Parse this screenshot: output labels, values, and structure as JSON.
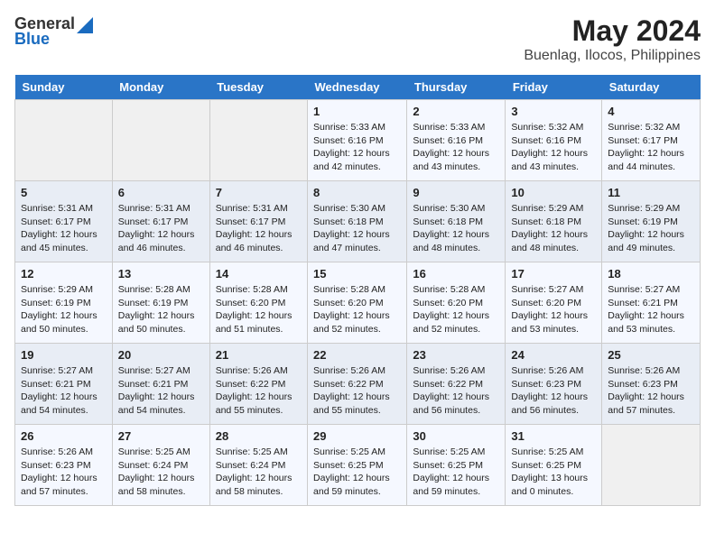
{
  "header": {
    "logo_general": "General",
    "logo_blue": "Blue",
    "title": "May 2024",
    "subtitle": "Buenlag, Ilocos, Philippines"
  },
  "days_of_week": [
    "Sunday",
    "Monday",
    "Tuesday",
    "Wednesday",
    "Thursday",
    "Friday",
    "Saturday"
  ],
  "weeks": [
    [
      {
        "num": "",
        "info": ""
      },
      {
        "num": "",
        "info": ""
      },
      {
        "num": "",
        "info": ""
      },
      {
        "num": "1",
        "info": "Sunrise: 5:33 AM\nSunset: 6:16 PM\nDaylight: 12 hours\nand 42 minutes."
      },
      {
        "num": "2",
        "info": "Sunrise: 5:33 AM\nSunset: 6:16 PM\nDaylight: 12 hours\nand 43 minutes."
      },
      {
        "num": "3",
        "info": "Sunrise: 5:32 AM\nSunset: 6:16 PM\nDaylight: 12 hours\nand 43 minutes."
      },
      {
        "num": "4",
        "info": "Sunrise: 5:32 AM\nSunset: 6:17 PM\nDaylight: 12 hours\nand 44 minutes."
      }
    ],
    [
      {
        "num": "5",
        "info": "Sunrise: 5:31 AM\nSunset: 6:17 PM\nDaylight: 12 hours\nand 45 minutes."
      },
      {
        "num": "6",
        "info": "Sunrise: 5:31 AM\nSunset: 6:17 PM\nDaylight: 12 hours\nand 46 minutes."
      },
      {
        "num": "7",
        "info": "Sunrise: 5:31 AM\nSunset: 6:17 PM\nDaylight: 12 hours\nand 46 minutes."
      },
      {
        "num": "8",
        "info": "Sunrise: 5:30 AM\nSunset: 6:18 PM\nDaylight: 12 hours\nand 47 minutes."
      },
      {
        "num": "9",
        "info": "Sunrise: 5:30 AM\nSunset: 6:18 PM\nDaylight: 12 hours\nand 48 minutes."
      },
      {
        "num": "10",
        "info": "Sunrise: 5:29 AM\nSunset: 6:18 PM\nDaylight: 12 hours\nand 48 minutes."
      },
      {
        "num": "11",
        "info": "Sunrise: 5:29 AM\nSunset: 6:19 PM\nDaylight: 12 hours\nand 49 minutes."
      }
    ],
    [
      {
        "num": "12",
        "info": "Sunrise: 5:29 AM\nSunset: 6:19 PM\nDaylight: 12 hours\nand 50 minutes."
      },
      {
        "num": "13",
        "info": "Sunrise: 5:28 AM\nSunset: 6:19 PM\nDaylight: 12 hours\nand 50 minutes."
      },
      {
        "num": "14",
        "info": "Sunrise: 5:28 AM\nSunset: 6:20 PM\nDaylight: 12 hours\nand 51 minutes."
      },
      {
        "num": "15",
        "info": "Sunrise: 5:28 AM\nSunset: 6:20 PM\nDaylight: 12 hours\nand 52 minutes."
      },
      {
        "num": "16",
        "info": "Sunrise: 5:28 AM\nSunset: 6:20 PM\nDaylight: 12 hours\nand 52 minutes."
      },
      {
        "num": "17",
        "info": "Sunrise: 5:27 AM\nSunset: 6:20 PM\nDaylight: 12 hours\nand 53 minutes."
      },
      {
        "num": "18",
        "info": "Sunrise: 5:27 AM\nSunset: 6:21 PM\nDaylight: 12 hours\nand 53 minutes."
      }
    ],
    [
      {
        "num": "19",
        "info": "Sunrise: 5:27 AM\nSunset: 6:21 PM\nDaylight: 12 hours\nand 54 minutes."
      },
      {
        "num": "20",
        "info": "Sunrise: 5:27 AM\nSunset: 6:21 PM\nDaylight: 12 hours\nand 54 minutes."
      },
      {
        "num": "21",
        "info": "Sunrise: 5:26 AM\nSunset: 6:22 PM\nDaylight: 12 hours\nand 55 minutes."
      },
      {
        "num": "22",
        "info": "Sunrise: 5:26 AM\nSunset: 6:22 PM\nDaylight: 12 hours\nand 55 minutes."
      },
      {
        "num": "23",
        "info": "Sunrise: 5:26 AM\nSunset: 6:22 PM\nDaylight: 12 hours\nand 56 minutes."
      },
      {
        "num": "24",
        "info": "Sunrise: 5:26 AM\nSunset: 6:23 PM\nDaylight: 12 hours\nand 56 minutes."
      },
      {
        "num": "25",
        "info": "Sunrise: 5:26 AM\nSunset: 6:23 PM\nDaylight: 12 hours\nand 57 minutes."
      }
    ],
    [
      {
        "num": "26",
        "info": "Sunrise: 5:26 AM\nSunset: 6:23 PM\nDaylight: 12 hours\nand 57 minutes."
      },
      {
        "num": "27",
        "info": "Sunrise: 5:25 AM\nSunset: 6:24 PM\nDaylight: 12 hours\nand 58 minutes."
      },
      {
        "num": "28",
        "info": "Sunrise: 5:25 AM\nSunset: 6:24 PM\nDaylight: 12 hours\nand 58 minutes."
      },
      {
        "num": "29",
        "info": "Sunrise: 5:25 AM\nSunset: 6:25 PM\nDaylight: 12 hours\nand 59 minutes."
      },
      {
        "num": "30",
        "info": "Sunrise: 5:25 AM\nSunset: 6:25 PM\nDaylight: 12 hours\nand 59 minutes."
      },
      {
        "num": "31",
        "info": "Sunrise: 5:25 AM\nSunset: 6:25 PM\nDaylight: 13 hours\nand 0 minutes."
      },
      {
        "num": "",
        "info": ""
      }
    ]
  ]
}
